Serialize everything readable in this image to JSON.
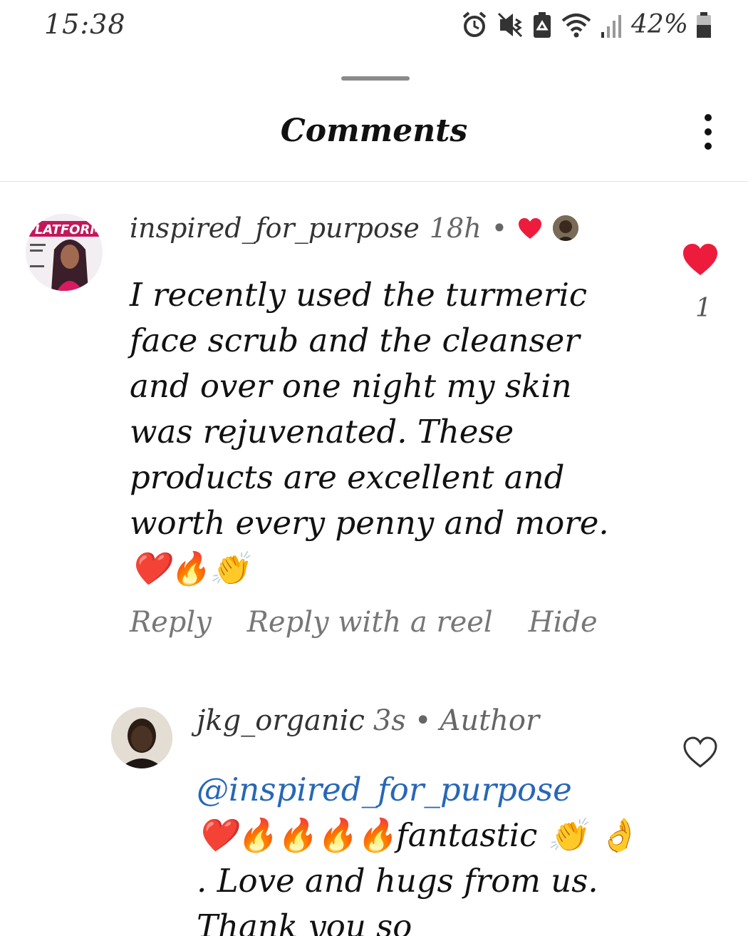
{
  "status_bar": {
    "time": "15:38",
    "battery_percent": "42%",
    "icons": [
      "alarm-icon",
      "vibrate-icon",
      "battery-saver-icon",
      "wifi-icon",
      "signal-icon",
      "battery-icon"
    ]
  },
  "header": {
    "title": "Comments",
    "more_icon": "more-vertical-icon"
  },
  "comments": [
    {
      "username": "inspired_for_purpose",
      "time": "18h",
      "separator": "•",
      "liked_by_creator": true,
      "text": "I recently used the turmeric face scrub and the cleanser and over one night my skin was rejuvenated. These products are excellent and worth every penny and more.❤️🔥👏",
      "actions": {
        "reply": "Reply",
        "reply_reel": "Reply with a reel",
        "hide": "Hide"
      },
      "like_count": "1",
      "liked": true,
      "like_color": "#ed1c3c"
    },
    {
      "username": "jkg_organic",
      "time": "3s",
      "separator": "•",
      "badge": "Author",
      "mention": "@inspired_for_purpose",
      "text": "❤️🔥🔥🔥🔥fantastic 👏 👌 . Love and hugs from us. Thank you so",
      "liked": false
    }
  ],
  "colors": {
    "mention": "#2767b7",
    "like": "#ed1c3c"
  }
}
